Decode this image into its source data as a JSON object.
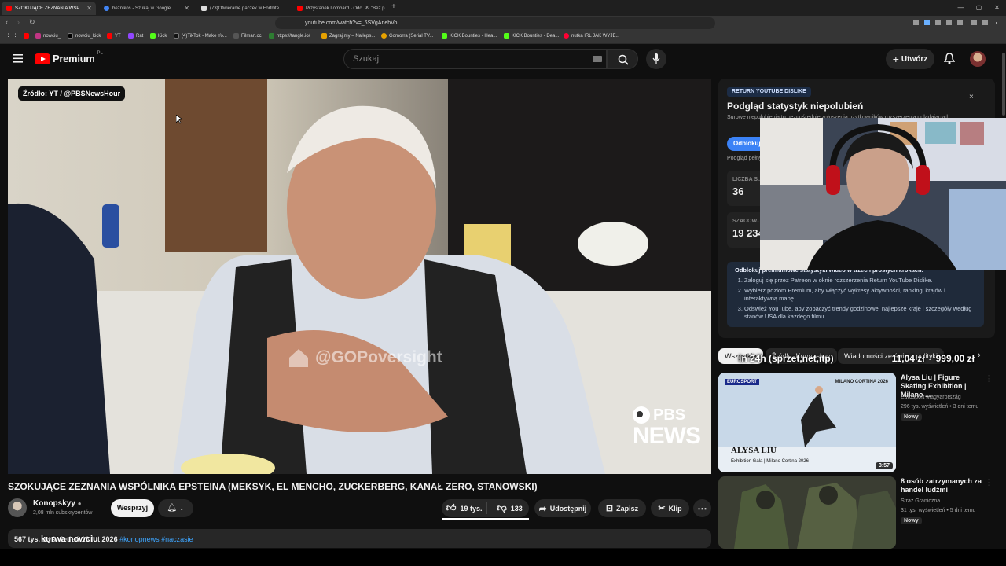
{
  "browser": {
    "tabs": [
      {
        "title": "SZOKUJĄCE ZEZNANIA WSP...",
        "active": true,
        "color": "#ff0000"
      },
      {
        "title": "beznikos - Szukaj w Google",
        "active": false,
        "color": "#4285f4"
      },
      {
        "title": "(73)Otwieranie paczek w Fortnite",
        "active": false,
        "color": "#222"
      },
      {
        "title": "Przystanek Lombard - Odc. 99 \"Bez p",
        "active": false,
        "color": "#ff0000"
      }
    ],
    "new_tab_glyph": "+",
    "url": "youtube.com/watch?v=_6SVgAnehVo",
    "bookmarks": [
      {
        "label": "nowciu_",
        "color": "#c13584"
      },
      {
        "label": "nowciu_kick",
        "color": "#000"
      },
      {
        "label": "YT",
        "color": "#ff0000"
      },
      {
        "label": "Rat",
        "color": "#9146ff"
      },
      {
        "label": "Kick",
        "color": "#53fc18"
      },
      {
        "label": "(4)TikTok - Make Yo...",
        "color": "#111"
      },
      {
        "label": "Filman.cc",
        "color": "#333"
      },
      {
        "label": "https://tangle.io/",
        "color": "#2e7d32"
      },
      {
        "label": "Zagraj.my – Najleps...",
        "color": "#e6a100"
      },
      {
        "label": "Gomorra (Serial TV...",
        "color": "#e6a100"
      },
      {
        "label": "KICK Bounties - Hea...",
        "color": "#53fc18"
      },
      {
        "label": "KICK Bounties - Dea...",
        "color": "#53fc18"
      },
      {
        "label": "nutka IRL JAK WYJE...",
        "color": "#ff0033"
      }
    ]
  },
  "youtube": {
    "logo_text": "Premium",
    "logo_region": "PL",
    "search_placeholder": "Szukaj",
    "create_label": "Utwórz"
  },
  "video": {
    "source_badge": "Źródło: YT / @PBSNewsHour",
    "watermark": "@GOPoversight",
    "pbs_line1": "PBS",
    "pbs_line2": "NEWS",
    "title": "SZOKUJĄCE ZEZNANIA WSPÓLNIKA EPSTEINA (MEKSYK, EL MENCHO, ZUCKERBERG, KANAŁ ZERO, STANOWSKI)",
    "channel": "Konopskyy",
    "subscribers": "2,08 mln subskrybentów",
    "support_label": "Wesprzyj",
    "likes": "19 tys.",
    "dislikes": "133",
    "share_label": "Udostępnij",
    "save_label": "Zapisz",
    "clip_label": "Klip",
    "desc_views": "567 tys. wyświetleń  16 lut 2026",
    "desc_overlay": "kurwa nowciu",
    "desc_tags": "#konopnews #naczasie"
  },
  "ryd": {
    "badge": "RETURN YOUTUBE DISLIKE",
    "title": "Podgląd statystyk niepolubień",
    "subtitle": "Surowe niepolubienia to bezpośrednie zgłoszenia użytkowników rozszerzenia oglądających...",
    "button": "Odblokuj",
    "peek": "Podgląd pełny...",
    "stat1_label": "LICZBA S...",
    "stat1_value": "36",
    "stat2_label": "SZACOW...",
    "stat2_value": "19 234",
    "steps_title": "Odblokuj premiumowe statystyki wideo w trzech prostych krokach:",
    "steps": [
      "Zaloguj się przez Patreon w oknie rozszerzenia Return YouTube Dislike.",
      "Wybierz poziom Premium, aby włączyć wykresy aktywności, rankingi krajów i interaktywną mapę.",
      "Odśwież YouTube, aby zobaczyć trendy godzinowe, najlepsze kraje i szczegóły według stanów USA dla każdego filmu."
    ]
  },
  "chips": [
    "Wszystkie",
    "Źródło: Konopskyy",
    "Wiadomości ze świata polityki"
  ],
  "overlay": {
    "label": "In 24h (sprzet,net,itp)",
    "v1": "11,04 zł",
    "v2": "999,00 zł"
  },
  "recommendations": [
    {
      "title": "Alysa Liu | Figure Skating Exhibition | Milano ...",
      "channel": "Eurosport Magyarország",
      "meta": "296 tys. wyświetleń • 3 dni temu",
      "badge": "Nowy",
      "duration": "3:57",
      "thumb_brand": "EUROSPORT",
      "thumb_event": "MILANO CORTINA 2026",
      "thumb_name": "ALYSA LIU",
      "thumb_caption": "Exhibition Gala | Milano Cortina 2026"
    },
    {
      "title": "8 osób zatrzymanych za handel ludźmi",
      "channel": "Straż Graniczna",
      "meta": "31 tys. wyświetleń • 5 dni temu",
      "badge": "Nowy",
      "duration": "",
      "thumb_brand": "",
      "thumb_event": "",
      "thumb_name": "",
      "thumb_caption": ""
    }
  ],
  "colors": {
    "accent": "#ff0000",
    "link": "#3ea6ff",
    "bg": "#0f0f0f",
    "ryd_blue": "#3b82f6"
  }
}
